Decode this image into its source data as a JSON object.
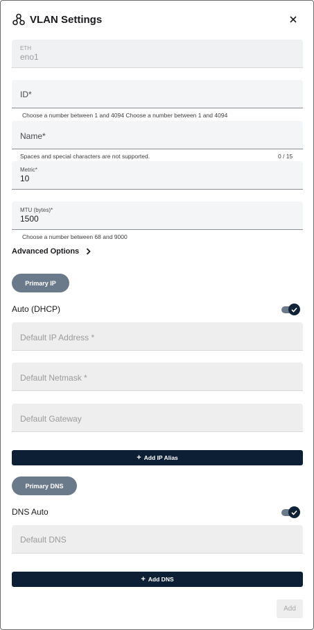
{
  "header": {
    "title": "VLAN Settings",
    "icon": "network-icon",
    "close_icon": "close-icon"
  },
  "eth": {
    "label": "ETH",
    "value": "eno1"
  },
  "id_field": {
    "placeholder": "ID*",
    "hint": "Choose a number between 1 and 4094 Choose a number between 1 and 4094"
  },
  "name_field": {
    "placeholder": "Name*",
    "hint": "Spaces and special characters are not supported.",
    "counter": "0 / 15"
  },
  "metric": {
    "label": "Metric*",
    "value": "10"
  },
  "mtu": {
    "label": "MTU (bytes)*",
    "value": "1500",
    "hint": "Choose a number between 68 and 9000"
  },
  "advanced": {
    "label": "Advanced Options"
  },
  "primary_ip": {
    "chip": "Primary IP",
    "auto_label": "Auto (DHCP)",
    "auto_on": true,
    "ip_placeholder": "Default IP Address *",
    "netmask_placeholder": "Default Netmask *",
    "gateway_placeholder": "Default Gateway",
    "add_alias": "Add IP Alias"
  },
  "primary_dns": {
    "chip": "Primary DNS",
    "auto_label": "DNS Auto",
    "auto_on": true,
    "dns_placeholder": "Default DNS",
    "add_dns": "Add DNS"
  },
  "footer": {
    "add_label": "Add"
  },
  "colors": {
    "navy": "#0c1f35",
    "chip": "#6b7a8a",
    "field_bg": "#f4f5f7"
  }
}
